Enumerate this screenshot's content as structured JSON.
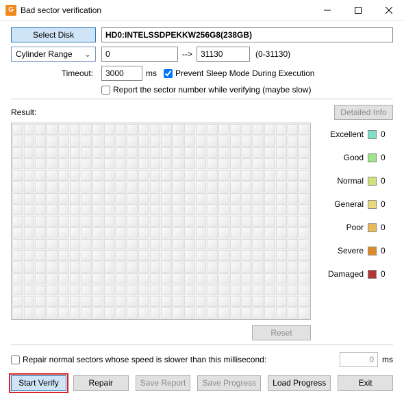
{
  "window": {
    "title": "Bad sector verification"
  },
  "toolbar": {
    "select_disk": "Select Disk",
    "disk_name": "HD0:INTELSSDPEKKW256G8(238GB)",
    "range_mode": "Cylinder Range",
    "range_start": "0",
    "range_end": "31130",
    "range_hint": "(0-31130)",
    "timeout_label": "Timeout:",
    "timeout_value": "3000",
    "timeout_unit": "ms",
    "prevent_sleep": "Prevent Sleep Mode During Execution",
    "report_sector": "Report the sector number while verifying (maybe slow)"
  },
  "result": {
    "label": "Result:",
    "detailed_info": "Detailed Info",
    "reset": "Reset"
  },
  "legend": {
    "items": [
      {
        "label": "Excellent",
        "color": "#7ee0c9",
        "count": "0"
      },
      {
        "label": "Good",
        "color": "#9fe38a",
        "count": "0"
      },
      {
        "label": "Normal",
        "color": "#d2e07a",
        "count": "0"
      },
      {
        "label": "General",
        "color": "#e8d97e",
        "count": "0"
      },
      {
        "label": "Poor",
        "color": "#e6b95a",
        "count": "0"
      },
      {
        "label": "Severe",
        "color": "#dd8a2a",
        "count": "0"
      },
      {
        "label": "Damaged",
        "color": "#b23636",
        "count": "0"
      }
    ]
  },
  "bottom": {
    "repair_slow": "Repair normal sectors whose speed is slower than this millisecond:",
    "repair_slow_value": "0",
    "repair_slow_unit": "ms"
  },
  "actions": {
    "start_verify": "Start Verify",
    "repair": "Repair",
    "save_report": "Save Report",
    "save_progress": "Save Progress",
    "load_progress": "Load Progress",
    "exit": "Exit"
  }
}
